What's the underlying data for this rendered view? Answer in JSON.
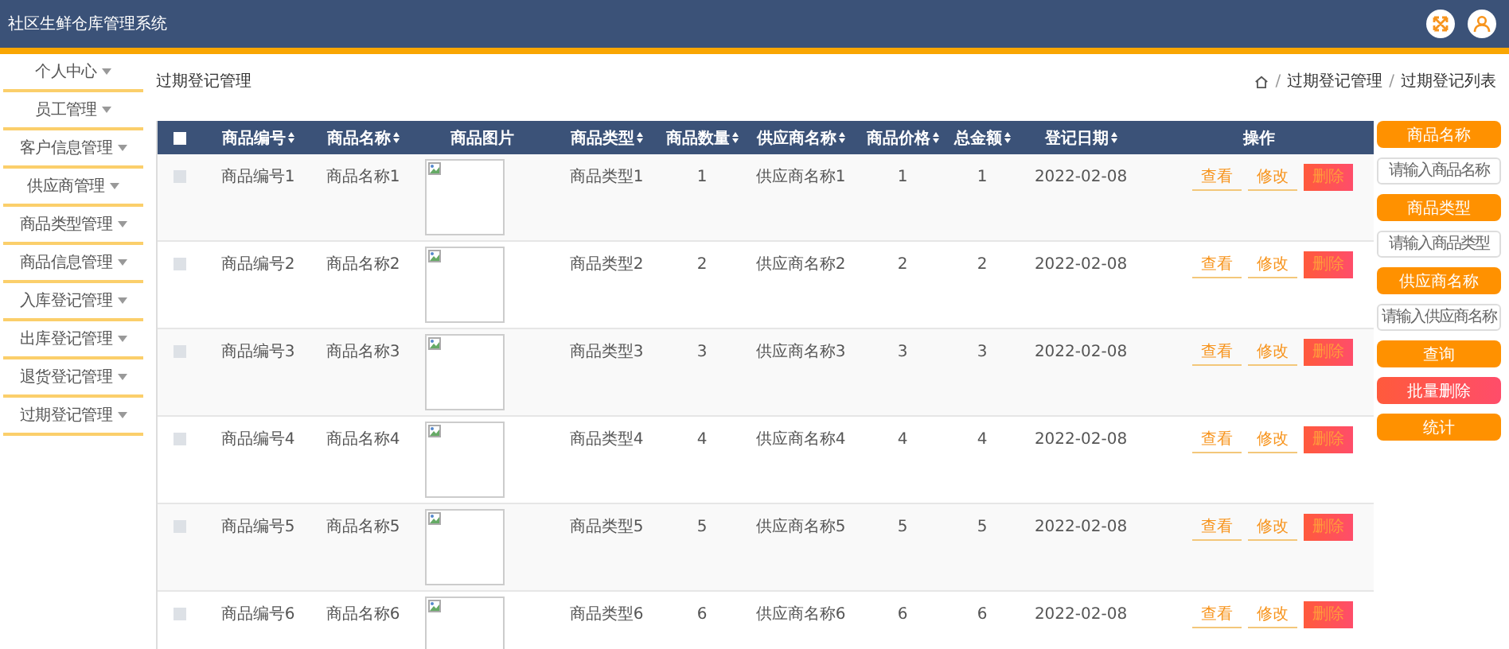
{
  "app_title": "社区生鲜仓库管理系统",
  "sidebar": {
    "items": [
      {
        "label": "个人中心"
      },
      {
        "label": "员工管理"
      },
      {
        "label": "客户信息管理"
      },
      {
        "label": "供应商管理"
      },
      {
        "label": "商品类型管理"
      },
      {
        "label": "商品信息管理"
      },
      {
        "label": "入库登记管理"
      },
      {
        "label": "出库登记管理"
      },
      {
        "label": "退货登记管理"
      },
      {
        "label": "过期登记管理"
      }
    ]
  },
  "page_title": "过期登记管理",
  "breadcrumb": [
    {
      "kind": "separator",
      "text": "/"
    },
    {
      "kind": "link",
      "text": "过期登记管理"
    },
    {
      "kind": "separator",
      "text": "/"
    },
    {
      "kind": "link",
      "text": "过期登记列表"
    }
  ],
  "table": {
    "select_all": {
      "checked": false
    },
    "columns": [
      {
        "label": "商品编号",
        "sortable": true
      },
      {
        "label": "商品名称",
        "sortable": true
      },
      {
        "label": "商品图片",
        "sortable": false
      },
      {
        "label": "商品类型",
        "sortable": true
      },
      {
        "label": "商品数量",
        "sortable": true
      },
      {
        "label": "供应商名称",
        "sortable": true
      },
      {
        "label": "商品价格",
        "sortable": true
      },
      {
        "label": "总金额",
        "sortable": true
      },
      {
        "label": "登记日期",
        "sortable": true
      },
      {
        "label": "操作",
        "sortable": false
      }
    ],
    "rows": [
      {
        "checked": false,
        "cells": [
          "商品编号1",
          "商品名称1",
          {
            "kind": "picture"
          },
          "商品类型1",
          "1",
          "供应商名称1",
          "1",
          "1",
          "2022-02-08"
        ],
        "actions": [
          "查看",
          "修改",
          "删除"
        ]
      },
      {
        "checked": false,
        "cells": [
          "商品编号2",
          "商品名称2",
          {
            "kind": "picture"
          },
          "商品类型2",
          "2",
          "供应商名称2",
          "2",
          "2",
          "2022-02-08"
        ],
        "actions": [
          "查看",
          "修改",
          "删除"
        ]
      },
      {
        "checked": false,
        "cells": [
          "商品编号3",
          "商品名称3",
          {
            "kind": "picture"
          },
          "商品类型3",
          "3",
          "供应商名称3",
          "3",
          "3",
          "2022-02-08"
        ],
        "actions": [
          "查看",
          "修改",
          "删除"
        ]
      },
      {
        "checked": false,
        "cells": [
          "商品编号4",
          "商品名称4",
          {
            "kind": "picture"
          },
          "商品类型4",
          "4",
          "供应商名称4",
          "4",
          "4",
          "2022-02-08"
        ],
        "actions": [
          "查看",
          "修改",
          "删除"
        ]
      },
      {
        "checked": false,
        "cells": [
          "商品编号5",
          "商品名称5",
          {
            "kind": "picture"
          },
          "商品类型5",
          "5",
          "供应商名称5",
          "5",
          "5",
          "2022-02-08"
        ],
        "actions": [
          "查看",
          "修改",
          "删除"
        ]
      },
      {
        "checked": false,
        "cells": [
          "商品编号6",
          "商品名称6",
          {
            "kind": "picture"
          },
          "商品类型6",
          "6",
          "供应商名称6",
          "6",
          "6",
          "2022-02-08"
        ],
        "actions": [
          "查看",
          "修改",
          "删除"
        ]
      }
    ]
  },
  "search_panel": {
    "filters": [
      {
        "label": "商品名称",
        "placeholder": "请输入商品名称"
      },
      {
        "label": "商品类型",
        "placeholder": "请输入商品类型"
      },
      {
        "label": "供应商名称",
        "placeholder": "请输入供应商名称"
      }
    ],
    "buttons": [
      {
        "label": "查询",
        "kind": "primary"
      },
      {
        "label": "批量删除",
        "kind": "danger"
      },
      {
        "label": "统计",
        "kind": "primary"
      }
    ]
  }
}
